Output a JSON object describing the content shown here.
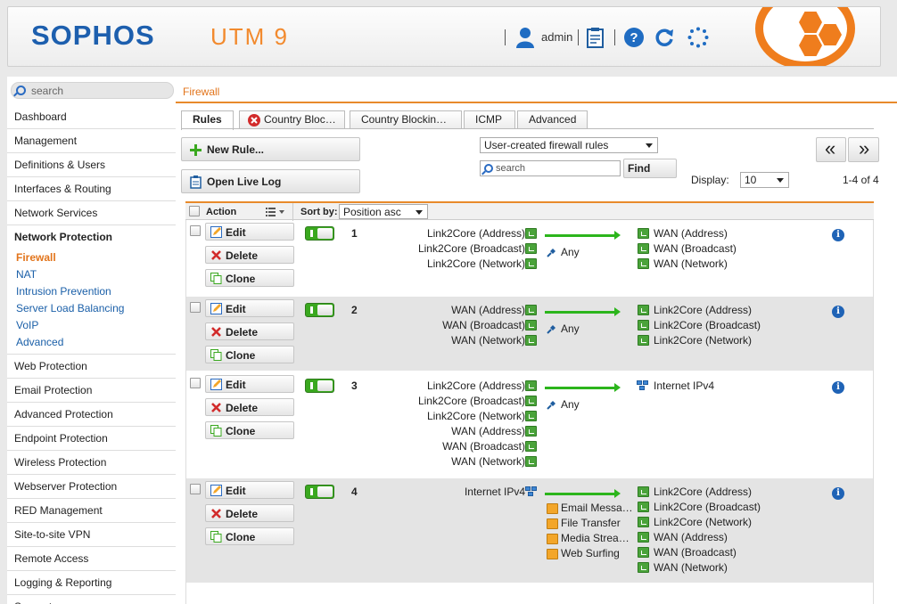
{
  "header": {
    "logo": "SOPHOS",
    "product": "UTM 9",
    "user": "admin",
    "icons": [
      "user-icon",
      "report-icon",
      "help-icon",
      "refresh-icon",
      "busy-spinner-icon"
    ],
    "colors": {
      "brand_blue": "#1d5fae",
      "accent_orange": "#ef7d1d",
      "toggle_green": "#3aa81f"
    }
  },
  "sidebar": {
    "search_placeholder": "search",
    "items": [
      {
        "label": "Dashboard"
      },
      {
        "label": "Management"
      },
      {
        "label": "Definitions & Users"
      },
      {
        "label": "Interfaces & Routing"
      },
      {
        "label": "Network Services"
      },
      {
        "label": "Network Protection",
        "expanded": true,
        "children": [
          "Firewall",
          "NAT",
          "Intrusion Prevention",
          "Server Load Balancing",
          "VoIP",
          "Advanced"
        ],
        "current": "Firewall"
      },
      {
        "label": "Web Protection"
      },
      {
        "label": "Email Protection"
      },
      {
        "label": "Advanced Protection"
      },
      {
        "label": "Endpoint Protection"
      },
      {
        "label": "Wireless Protection"
      },
      {
        "label": "Webserver Protection"
      },
      {
        "label": "RED Management"
      },
      {
        "label": "Site-to-site VPN"
      },
      {
        "label": "Remote Access"
      },
      {
        "label": "Logging & Reporting"
      },
      {
        "label": "Support"
      }
    ]
  },
  "breadcrumb": "Firewall",
  "tabs": [
    "Rules",
    "Country Bloc…",
    "Country Blockin…",
    "ICMP",
    "Advanced"
  ],
  "toolbar": {
    "new_rule": "New Rule...",
    "open_live_log": "Open Live Log",
    "filter_select": "User-created firewall rules",
    "search_placeholder": "search",
    "find": "Find",
    "display_label": "Display:",
    "display_value": "10",
    "count": "1-4 of 4",
    "first": "«",
    "prev": "»"
  },
  "grid": {
    "action_header": "Action",
    "sort_label": "Sort by:",
    "sort_value": "Position asc",
    "buttons": {
      "edit": "Edit",
      "delete": "Delete",
      "clone": "Clone"
    },
    "rules": [
      {
        "num": "1",
        "sources": [
          "Link2Core (Address)",
          "Link2Core (Broadcast)",
          "Link2Core (Network)"
        ],
        "services": [
          "Any"
        ],
        "destinations": [
          "WAN (Address)",
          "WAN (Broadcast)",
          "WAN (Network)"
        ]
      },
      {
        "num": "2",
        "sources": [
          "WAN (Address)",
          "WAN (Broadcast)",
          "WAN (Network)"
        ],
        "services": [
          "Any"
        ],
        "destinations": [
          "Link2Core (Address)",
          "Link2Core (Broadcast)",
          "Link2Core (Network)"
        ]
      },
      {
        "num": "3",
        "sources": [
          "Link2Core (Address)",
          "Link2Core (Broadcast)",
          "Link2Core (Network)",
          "WAN (Address)",
          "WAN (Broadcast)",
          "WAN (Network)"
        ],
        "services": [
          "Any"
        ],
        "destinations": [
          "Internet IPv4"
        ]
      },
      {
        "num": "4",
        "sources": [
          "Internet IPv4"
        ],
        "services": [
          "Email Messa…",
          "File Transfer",
          "Media Strea…",
          "Web Surfing"
        ],
        "destinations": [
          "Link2Core (Address)",
          "Link2Core (Broadcast)",
          "Link2Core (Network)",
          "WAN (Address)",
          "WAN (Broadcast)",
          "WAN (Network)"
        ]
      }
    ]
  }
}
